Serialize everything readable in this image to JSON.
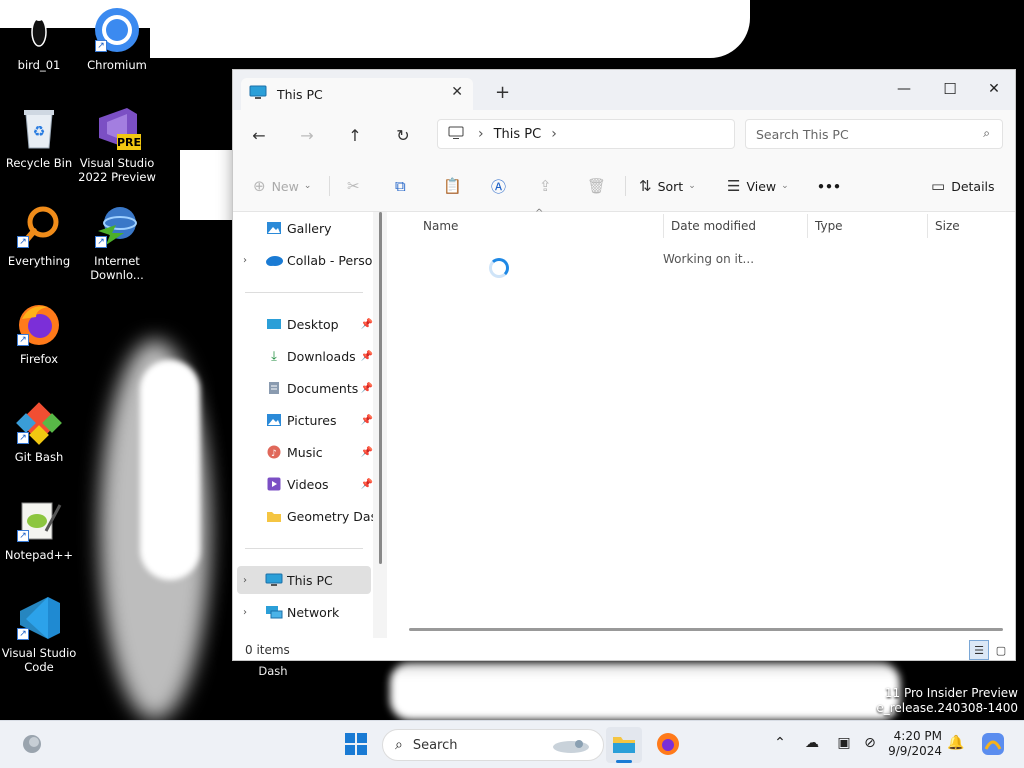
{
  "desktop": {
    "icons": [
      {
        "label": "bird_01",
        "icon": "bird-icon"
      },
      {
        "label": "Chromium",
        "icon": "chromium-icon"
      },
      {
        "label": "Recycle Bin",
        "icon": "recycle-bin-icon"
      },
      {
        "label": "Visual Studio 2022 Preview",
        "icon": "visual-studio-preview-icon",
        "badge": "PRE"
      },
      {
        "label": "Everything",
        "icon": "everything-search-icon"
      },
      {
        "label": "Internet Downlo...",
        "icon": "internet-download-manager-icon"
      },
      {
        "label": "Firefox",
        "icon": "firefox-icon"
      },
      {
        "label": "Git Bash",
        "icon": "git-bash-icon"
      },
      {
        "label": "Notepad++",
        "icon": "notepad-plus-plus-icon"
      },
      {
        "label": "Visual Studio Code",
        "icon": "vscode-icon"
      },
      {
        "label": "Dash",
        "icon": "geometry-dash-icon"
      }
    ],
    "watermark": {
      "line1": "11 Pro Insider Preview",
      "line2": "e_release.240308-1400"
    }
  },
  "explorer": {
    "tab": {
      "title": "This PC",
      "new_tab": "+"
    },
    "window_controls": {
      "minimize": "—",
      "maximize": "☐",
      "close": "✕"
    },
    "address": {
      "crumb": "This PC"
    },
    "search": {
      "placeholder": "Search This PC"
    },
    "commands": {
      "new": "New",
      "sort": "Sort",
      "view": "View",
      "more": "•••",
      "details": "Details"
    },
    "nav": [
      {
        "label": "Gallery",
        "icon": "gallery-icon"
      },
      {
        "label": "Collab - Personal",
        "icon": "onedrive-icon"
      },
      {
        "label": "Desktop",
        "icon": "desktop-folder-icon",
        "pinned": true
      },
      {
        "label": "Downloads",
        "icon": "downloads-icon",
        "pinned": true
      },
      {
        "label": "Documents",
        "icon": "documents-icon",
        "pinned": true
      },
      {
        "label": "Pictures",
        "icon": "pictures-icon",
        "pinned": true
      },
      {
        "label": "Music",
        "icon": "music-icon",
        "pinned": true
      },
      {
        "label": "Videos",
        "icon": "videos-icon",
        "pinned": true
      },
      {
        "label": "Geometry Dash",
        "icon": "folder-icon"
      },
      {
        "label": "This PC",
        "icon": "this-pc-icon",
        "selected": true
      },
      {
        "label": "Network",
        "icon": "network-icon"
      }
    ],
    "columns": [
      "Name",
      "Date modified",
      "Type",
      "Size"
    ],
    "status_message": "Working on it...",
    "status_bar": {
      "item_count": "0 items"
    }
  },
  "taskbar": {
    "search_label": "Search",
    "clock": {
      "time": "4:20 PM",
      "date": "9/9/2024"
    },
    "apps": [
      "start-icon",
      "file-explorer-icon",
      "firefox-icon"
    ],
    "tray": [
      "chevron-up-icon",
      "onedrive-icon",
      "display-icon",
      "network-off-icon",
      "notification-bell-icon",
      "copilot-icon"
    ]
  },
  "colors": {
    "accent": "#1e88e5",
    "window_bg": "#f9f9f9",
    "taskbar_bg": "#eef1f6"
  }
}
